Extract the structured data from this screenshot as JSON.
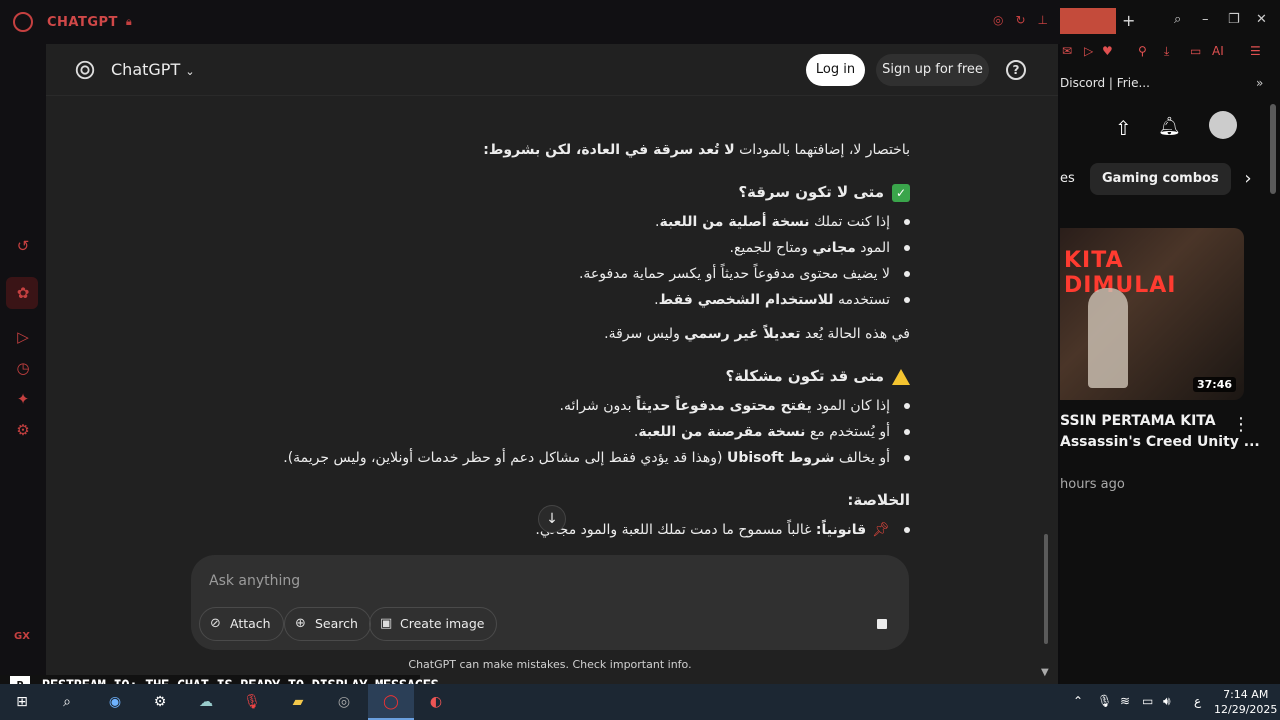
{
  "browser": {
    "title": "CHATGPT",
    "lock_icon": "lock-icon"
  },
  "chatgpt": {
    "model_name": "ChatGPT",
    "login_label": "Log in",
    "signup_label": "Sign up for free",
    "help_label": "?",
    "composer_placeholder": "Ask anything",
    "attach_label": "Attach",
    "search_label": "Search",
    "create_image_label": "Create image",
    "disclaimer": "ChatGPT can make mistakes. Check important info."
  },
  "message": {
    "intro_plain": "باختصار لا، إضافتهما بالمودات ",
    "intro_bold": "لا تُعد سرقة في العادة، لكن بشروط:",
    "section1_title": "متى لا تكون سرقة؟",
    "s1_b1_plain": "إذا كنت تملك ",
    "s1_b1_bold": "نسخة أصلية من اللعبة",
    "s1_b1_end": ".",
    "s1_b2_plain1": "المود ",
    "s1_b2_bold": "مجاني",
    "s1_b2_plain2": " ومتاح للجميع.",
    "s1_b3": "لا يضيف محتوى مدفوعاً حديثاً أو يكسر حماية مدفوعة.",
    "s1_b4_plain": "تستخدمه ",
    "s1_b4_bold": "للاستخدام الشخصي فقط",
    "s1_b4_end": ".",
    "s1_summary_plain1": "في هذه الحالة يُعد ",
    "s1_summary_bold": "تعديلاً غير رسمي",
    "s1_summary_plain2": " وليس سرقة.",
    "section2_title": "متى قد تكون مشكلة؟",
    "s2_b1_plain1": "إذا كان المود ",
    "s2_b1_bold": "يفتح محتوى مدفوعاً حديثاً",
    "s2_b1_plain2": " بدون شرائه.",
    "s2_b2_plain": "أو يُستخدم مع ",
    "s2_b2_bold": "نسخة مقرصنة من اللعبة",
    "s2_b2_end": ".",
    "s2_b3_plain1": "أو يخالف ",
    "s2_b3_bold": "شروط Ubisoft",
    "s2_b3_plain2": " (وهذا قد يؤدي فقط إلى مشاكل دعم أو حظر خدمات أونلاين، وليس جريمة).",
    "section3_title": "الخلاصة:",
    "s3_b1_bold": "قانونياً:",
    "s3_b1_plain": " غالباً مسموح ما دمت تملك اللعبة والمود مجاني."
  },
  "youtube": {
    "bookmark_discord": "Discord | Frie...",
    "chip_partial": "es",
    "chip_gaming": "Gaming combos",
    "thumb_text": "KITA DIMULAI",
    "duration": "37:46",
    "title_line1": "SSIN PERTAMA KITA",
    "title_line2": "Assassin's Creed Unity ...",
    "meta": "hours ago"
  },
  "restream": {
    "text": "RESTREAM.IO: THE CHAT IS READY TO DISPLAY MESSAGES"
  },
  "taskbar": {
    "lang": "ع",
    "time": "7:14 AM",
    "date": "12/29/2025"
  }
}
